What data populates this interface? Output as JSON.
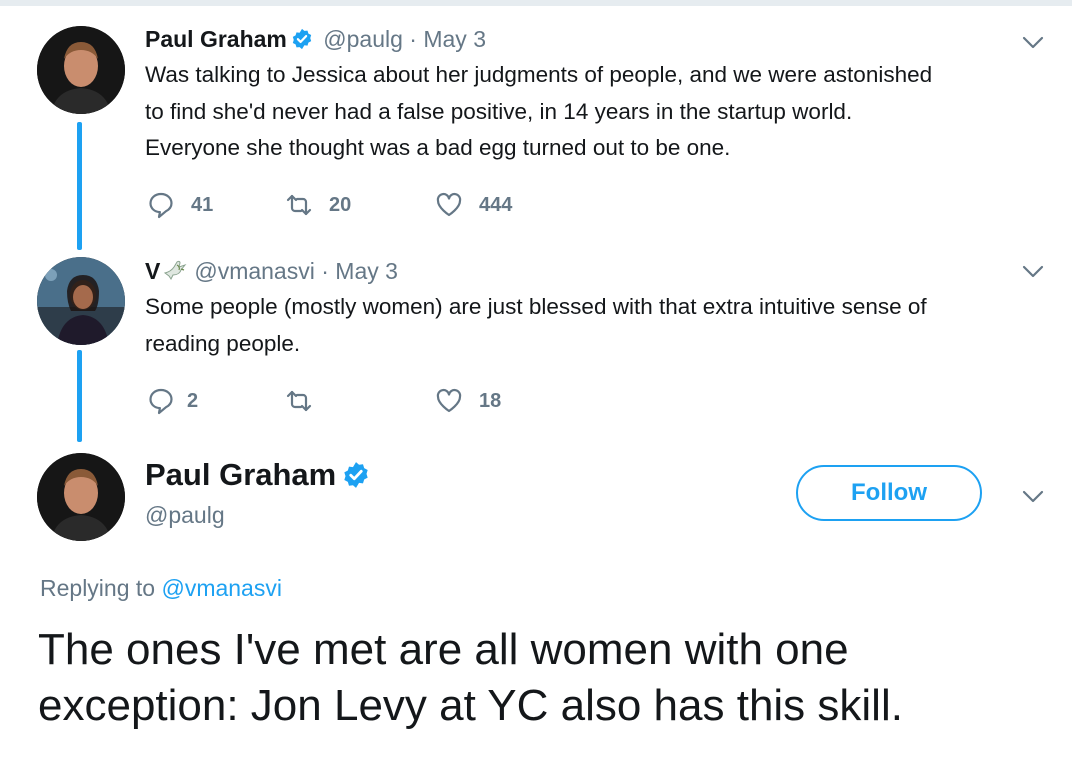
{
  "colors": {
    "accent": "#1da1f2",
    "muted": "#657786",
    "text": "#14171a",
    "like": "#657786"
  },
  "tweets": [
    {
      "name": "Paul Graham",
      "verified": true,
      "handle": "@paulg",
      "separator": "·",
      "date": "May 3",
      "text_lines": [
        "Was talking to Jessica about her judgments of people, and we were astonished",
        "to find she'd never had a false positive, in 14 years in the startup world.",
        "Everyone she thought was a bad egg turned out to be one."
      ],
      "replies": "41",
      "retweets": "20",
      "likes": "444"
    },
    {
      "name": "V",
      "name_emoji_icon": "dove-icon",
      "verified": false,
      "handle": "@vmanasvi",
      "separator": "·",
      "date": "May 3",
      "text_lines": [
        "Some people (mostly women) are just blessed with that extra intuitive sense of",
        "reading people."
      ],
      "replies": "2",
      "retweets": "",
      "likes": "18"
    }
  ],
  "focus_tweet": {
    "name": "Paul Graham",
    "verified": true,
    "handle": "@paulg",
    "follow_label": "Follow",
    "replying_prefix": "Replying to",
    "replying_to": "@vmanasvi",
    "text_lines": [
      "The ones I've met are all women with one",
      "exception: Jon Levy at YC also has this skill."
    ]
  }
}
